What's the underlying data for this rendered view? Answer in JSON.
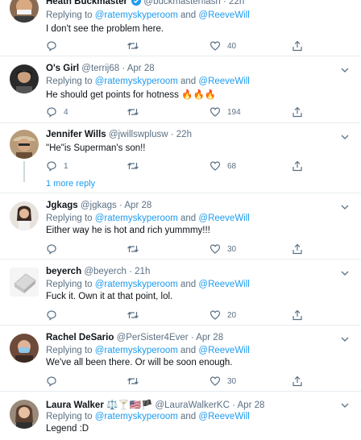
{
  "tweets": [
    {
      "name": "Heath Buckmaster",
      "handle": "@buckmasterflash",
      "time": "22h",
      "replying_prefix": "Replying to",
      "mention1": "@ratemyskyperoom",
      "and": "and",
      "mention2": "@ReeveWill",
      "text": "I don't see the problem here.",
      "replies": "",
      "likes": "40"
    },
    {
      "name": "O's Girl",
      "handle": "@terrij68",
      "time": "Apr 28",
      "replying_prefix": "Replying to",
      "mention1": "@ratemyskyperoom",
      "and": "and",
      "mention2": "@ReeveWill",
      "text": "He should get points for hotness 🔥🔥🔥",
      "replies": "4",
      "likes": "194"
    },
    {
      "name": "Jennifer Wills",
      "handle": "@jwillswplusw",
      "time": "22h",
      "text": "\"He\"is Superman's son!!",
      "replies": "1",
      "likes": "68",
      "more_replies": "1 more reply"
    },
    {
      "name": "Jgkags",
      "handle": "@jgkags",
      "time": "Apr 28",
      "replying_prefix": "Replying to",
      "mention1": "@ratemyskyperoom",
      "and": "and",
      "mention2": "@ReeveWill",
      "text": "Either way he is hot and rich yummmy!!!",
      "replies": "",
      "likes": "30"
    },
    {
      "name": "beyerch",
      "handle": "@beyerch",
      "time": "21h",
      "replying_prefix": "Replying to",
      "mention1": "@ratemyskyperoom",
      "and": "and",
      "mention2": "@ReeveWill",
      "text": "Fuck it.  Own it at that point, lol.",
      "replies": "",
      "likes": "20"
    },
    {
      "name": "Rachel DeSario",
      "handle": "@PerSister4Ever",
      "time": "Apr 28",
      "replying_prefix": "Replying to",
      "mention1": "@ratemyskyperoom",
      "and": "and",
      "mention2": "@ReeveWill",
      "text": "We've all been there. Or will be soon enough.",
      "replies": "",
      "likes": "30"
    },
    {
      "name": "Laura Walker",
      "name_emoji": "⚖️🍸🇺🇸🏴",
      "handle": "@LauraWalkerKC",
      "time": "Apr 28",
      "replying_prefix": "Replying to",
      "mention1": "@ratemyskyperoom",
      "and": "and",
      "mention2": "@ReeveWill",
      "text": "Legend :D"
    }
  ],
  "separator": "·",
  "icons": [
    "reply-icon",
    "retweet-icon",
    "like-icon",
    "share-icon",
    "more-caret-icon",
    "verified-badge-icon"
  ],
  "colors": {
    "link": "#1d9bf0",
    "muted": "#5b7083",
    "divider": "#e6ecf0",
    "verified": "#1d9bf0"
  }
}
